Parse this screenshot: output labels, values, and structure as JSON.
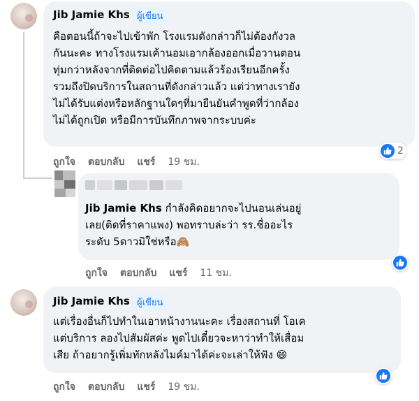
{
  "colors": {
    "accent": "#1877f2",
    "bubble": "#f0f2f5",
    "meta": "#65676b"
  },
  "comments": [
    {
      "author": "Jib Jamie Khs",
      "badge": "ผู้เขียน",
      "lines": [
        "คือตอนนี้ถ้าจะไปเข้าพัก โรงแรมดังกล่าวก็ไม่ต้องกังวล",
        "กันนะคะ ทางโรงแรมเค้านอมเอากล้องออกเมื่อวานตอน",
        "ทุ่มกว่าหลังจากที่ติดต่อไปคิดตามแล้วร้องเรียนอีกครั้ง",
        "รวมถึงปิดบริการในสถานที่ดังกล่าวแล้ว แต่ว่าทางเรายัง",
        "ไม่ได้รับแต่งหรือหลักฐานใดๆที่มายืนยันคำพูดที่ว่ากล้อง",
        "ไม่ได้ถูกเปิด หรือมีการบันทึกภาพจากระบบค่ะ"
      ],
      "actions": {
        "like": "ถูกใจ",
        "reply": "ตอบกลับ",
        "share": "แชร์",
        "time": "19 ชม."
      },
      "reaction_icon": "like-icon",
      "reaction_count": "2"
    },
    {
      "mention": "Jib Jamie Khs",
      "lines": [
        "กำลังคิดอยากจะไปนอนเล่นอยู่",
        "เลย(ติดที่ราคาแพง) พอทราบล่ะว่า รร.ชื่ออะไร",
        "ระดับ 5ดาวมิใช่หรือ🙈"
      ],
      "actions": {
        "like": "ถูกใจ",
        "reply": "ตอบกลับ",
        "share": "แชร์",
        "time": "11 ชม."
      },
      "reaction_icon": "like-icon"
    },
    {
      "author": "Jib Jamie Khs",
      "badge": "ผู้เขียน",
      "lines": [
        "แต่เรื่องอื่นก็ไปทำในเอาหน้างานนะคะ เรื่องสถานที่ โอเค",
        "แต่บริการ ลองไปสัมผัสค่ะ พูดไปเดี๋ยวจะหาว่าทำให้เสื่อม",
        "เสีย ถ้าอยากรู้เพิ่มทักหลังไมค์มาได้ค่ะจะเล่าให้ฟัง 😄"
      ],
      "actions": {
        "like": "ถูกใจ",
        "reply": "ตอบกลับ",
        "share": "แชร์",
        "time": "19 ชม."
      },
      "reaction_icon": "like-icon"
    }
  ]
}
